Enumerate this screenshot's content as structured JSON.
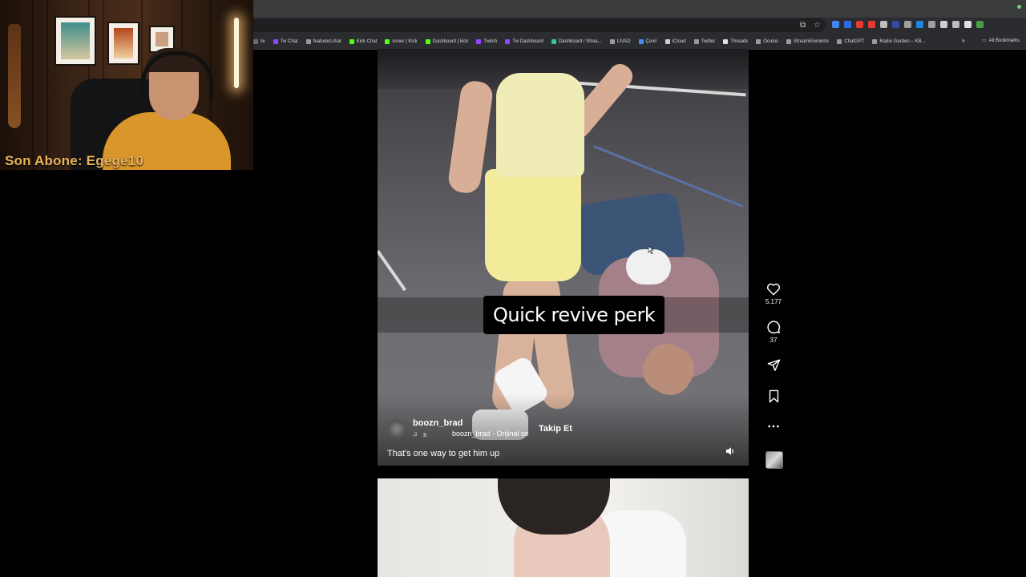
{
  "stream_overlay": {
    "subscriber_text": "Son Abone: Egege10"
  },
  "bookmarks": {
    "items": [
      {
        "label": "lix",
        "icon": "link-icon",
        "color": "#6b6b6b"
      },
      {
        "label": "Tw Chat",
        "icon": "twitch-icon",
        "color": "#9146ff"
      },
      {
        "label": "featured.chat",
        "icon": "globe-icon",
        "color": "#9a9a9a"
      },
      {
        "label": "Kick Chat",
        "icon": "kick-icon",
        "color": "#53fc18"
      },
      {
        "label": "soner | Kick",
        "icon": "kick-icon",
        "color": "#53fc18"
      },
      {
        "label": "Dashboard | kick",
        "icon": "kick-icon",
        "color": "#53fc18"
      },
      {
        "label": "Twitch",
        "icon": "twitch-icon",
        "color": "#9146ff"
      },
      {
        "label": "Tw Dashboard",
        "icon": "twitch-icon",
        "color": "#9146ff"
      },
      {
        "label": "Dashboard / Strea...",
        "icon": "streamlabs-icon",
        "color": "#31c3a2"
      },
      {
        "label": "LIVAD",
        "icon": "globe-icon",
        "color": "#9a9a9a"
      },
      {
        "label": "Çevir",
        "icon": "translate-icon",
        "color": "#4a8af4"
      },
      {
        "label": "iCloud",
        "icon": "cloud-icon",
        "color": "#cfcfcf"
      },
      {
        "label": "Twitter",
        "icon": "globe-icon",
        "color": "#9a9a9a"
      },
      {
        "label": "Threads",
        "icon": "threads-icon",
        "color": "#e0e0e0"
      },
      {
        "label": "Oculus",
        "icon": "globe-icon",
        "color": "#9a9a9a"
      },
      {
        "label": "StreamElements",
        "icon": "globe-icon",
        "color": "#9a9a9a"
      },
      {
        "label": "ChatGPT",
        "icon": "globe-icon",
        "color": "#9a9a9a"
      },
      {
        "label": "Radio Garden – KB...",
        "icon": "globe-icon",
        "color": "#9a9a9a"
      }
    ],
    "more_label": "»",
    "all_label": "All Bookmarks"
  },
  "extension_colors": [
    "#4285f4",
    "#2b6de8",
    "#e53935",
    "#e53935",
    "#bdbdbd",
    "#3949ab",
    "#9e9e9e",
    "#1e88e5",
    "#9e9e9e",
    "#cfcfcf",
    "#bdbdbd",
    "#e0e0e0",
    "#43a047"
  ],
  "reel": {
    "overlay_caption": "Quick revive perk",
    "username": "boozn_brad",
    "audio_short": "s",
    "audio_label": "boozn_brad · Orijinal se",
    "follow_label": "Takip Et",
    "caption": "That's one way to get him up"
  },
  "actions": {
    "like_count": "5.177",
    "comment_count": "37"
  }
}
